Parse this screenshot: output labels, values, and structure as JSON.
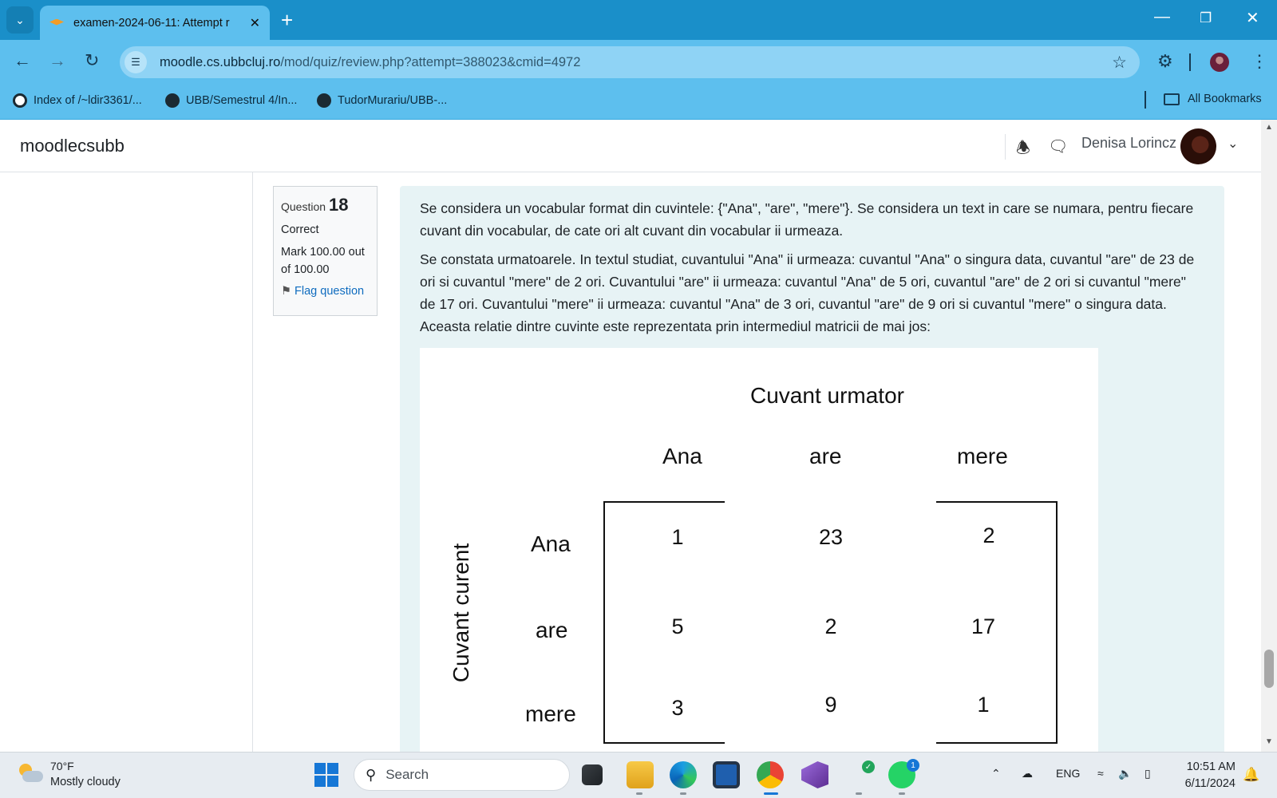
{
  "browser": {
    "tab_title": "examen-2024-06-11: Attempt r",
    "url_host": "moodle.cs.ubbcluj.ro",
    "url_path": "/mod/quiz/review.php?attempt=388023&cmid=4972",
    "bookmarks": [
      {
        "label": "Index of /~ldir3361/...",
        "icon": "globe-icon"
      },
      {
        "label": "UBB/Semestrul 4/In...",
        "icon": "github-icon"
      },
      {
        "label": "TudorMurariu/UBB-...",
        "icon": "github-icon"
      }
    ],
    "all_bookmarks_label": "All Bookmarks"
  },
  "moodle": {
    "brand": "moodlecsubb",
    "username": "Denisa Lorincz"
  },
  "question": {
    "label": "Question",
    "number": "18",
    "state": "Correct",
    "grade": "Mark 100.00 out of 100.00",
    "flag_label": "Flag question",
    "paragraph1": "Se considera un vocabular format din cuvintele: {\"Ana\", \"are\", \"mere\"}. Se considera un text in care se numara, pentru fiecare cuvant din vocabular, de cate ori alt cuvant din vocabular ii urmeaza.",
    "paragraph2": "Se constata urmatoarele. In textul studiat, cuvantului \"Ana\" ii urmeaza: cuvantul \"Ana\" o singura data, cuvantul \"are\" de 23 de ori si cuvantul \"mere\" de 2 ori. Cuvantului \"are\" ii urmeaza: cuvantul \"Ana\" de 5 ori, cuvantul \"are\" de 2 ori si cuvantul \"mere\" de 17 ori. Cuvantului \"mere\" ii urmeaza: cuvantul \"Ana\" de 3 ori, cuvantul \"are\" de 9 ori si cuvantul \"mere\" o singura data. Aceasta relatie dintre cuvinte este reprezentata prin intermediul matricii de mai jos:"
  },
  "matrix": {
    "col_title": "Cuvant urmator",
    "row_title": "Cuvant curent",
    "col_labels": [
      "Ana",
      "are",
      "mere"
    ],
    "row_labels": [
      "Ana",
      "are",
      "mere"
    ],
    "rows": [
      [
        "1",
        "23",
        "2"
      ],
      [
        "5",
        "2",
        "17"
      ],
      [
        "3",
        "9",
        "1"
      ]
    ]
  },
  "taskbar": {
    "temperature": "70°F",
    "condition": "Mostly cloudy",
    "search_placeholder": "Search",
    "language": "ENG",
    "time": "10:51 AM",
    "date": "6/11/2024",
    "whatsapp_badge": "1"
  }
}
